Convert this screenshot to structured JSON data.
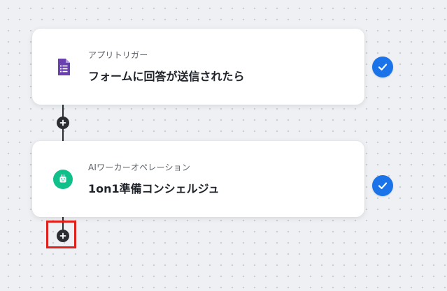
{
  "workflow": {
    "steps": [
      {
        "type_label": "アプリトリガー",
        "title": "フォームに回答が送信されたら",
        "icon": "google-forms-icon",
        "icon_color": "#673ab7",
        "status": "completed"
      },
      {
        "type_label": "AIワーカーオペレーション",
        "title": "1on1準備コンシェルジュ",
        "icon": "ai-worker-icon",
        "icon_color": "#10b981",
        "status": "completed"
      }
    ],
    "add_step_icon": "plus-icon",
    "status_icon": "check-icon",
    "status_color": "#1a73e8",
    "highlight_color": "#e0201b"
  }
}
